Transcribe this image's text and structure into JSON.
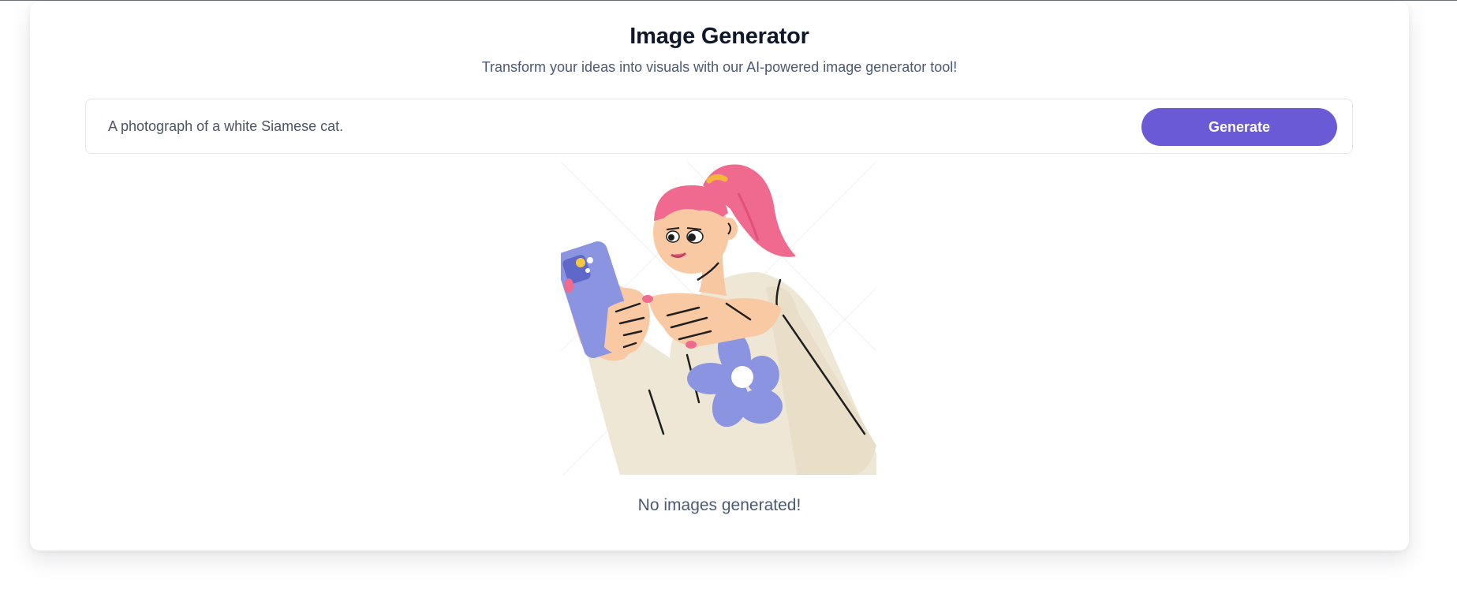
{
  "header": {
    "title": "Image Generator",
    "subtitle": "Transform your ideas into visuals with our AI-powered image generator tool!"
  },
  "prompt": {
    "value": "A photograph of a white Siamese cat.",
    "button_label": "Generate"
  },
  "gallery": {
    "empty_message": "No images generated!"
  },
  "colors": {
    "accent": "#6a5ad6",
    "title": "#0f172a",
    "muted_text": "#4b5a72",
    "border": "#e3e6eb"
  },
  "illustration": {
    "icon": "woman-with-phone-illustration"
  }
}
